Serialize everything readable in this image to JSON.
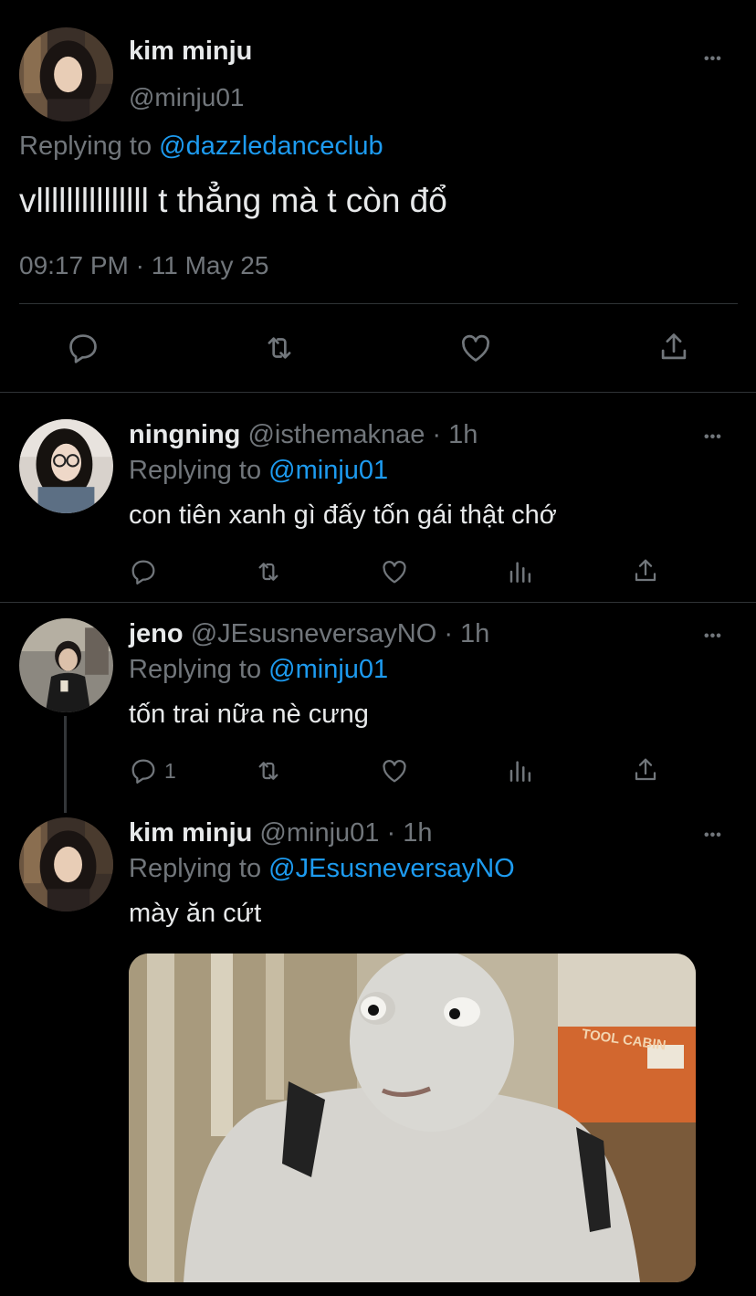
{
  "main_tweet": {
    "display_name": "kim minju",
    "handle": "@minju01",
    "replying_label": "Replying to",
    "replying_to": "@dazzledanceclub",
    "text": "vlllllllllllllll t thẳng mà t còn đổ",
    "timestamp": "09:17 PM · 11 May 25"
  },
  "replies": [
    {
      "display_name": "ningning",
      "handle_time": "@isthemaknae · 1h",
      "replying_label": "Replying to",
      "replying_to": "@minju01",
      "text": "con tiên xanh gì đấy tốn gái thật chớ"
    },
    {
      "display_name": "jeno",
      "handle_time": "@JEsusneversayNO · 1h",
      "replying_label": "Replying to",
      "replying_to": "@minju01",
      "text": "tốn trai nữa nè cưng",
      "reply_count": "1"
    },
    {
      "display_name": "kim minju",
      "handle_time": "@minju01 · 1h",
      "replying_label": "Replying to",
      "replying_to": "@JEsusneversayNO",
      "text": "mày ăn cứt",
      "image_sign_text": "TOOL CABIN"
    }
  ],
  "more_glyph": "•••",
  "colors": {
    "background": "#000000",
    "text": "#e7e9ea",
    "secondary": "#71767b",
    "link": "#1d9bf0",
    "divider": "#2f3336"
  },
  "icons": [
    "reply-icon",
    "retweet-icon",
    "like-icon",
    "share-icon",
    "analytics-icon",
    "more-icon"
  ]
}
